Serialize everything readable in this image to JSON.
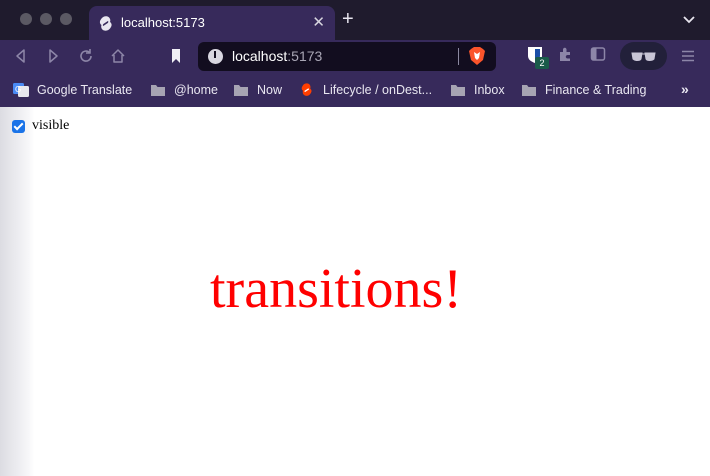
{
  "window": {
    "tab": {
      "title": "localhost:5173"
    }
  },
  "toolbar": {
    "url_host": "localhost",
    "url_port": ":5173",
    "extension_badge": "2"
  },
  "bookmarks": [
    {
      "label": "Google Translate",
      "icon": "google-translate-icon"
    },
    {
      "label": "@home",
      "icon": "folder-icon"
    },
    {
      "label": "Now",
      "icon": "folder-icon"
    },
    {
      "label": "Lifecycle / onDest...",
      "icon": "svelte-icon"
    },
    {
      "label": "Inbox",
      "icon": "folder-icon"
    },
    {
      "label": "Finance & Trading",
      "icon": "folder-icon"
    }
  ],
  "page": {
    "checkbox_label": "visible",
    "checkbox_checked": true,
    "headline": "transitions!",
    "headline_color": "#ff0000"
  },
  "colors": {
    "chrome": "#372a5b",
    "tabbar": "#1f1b2d",
    "urlbar": "#120d1f",
    "checkbox": "#1a73e8"
  }
}
